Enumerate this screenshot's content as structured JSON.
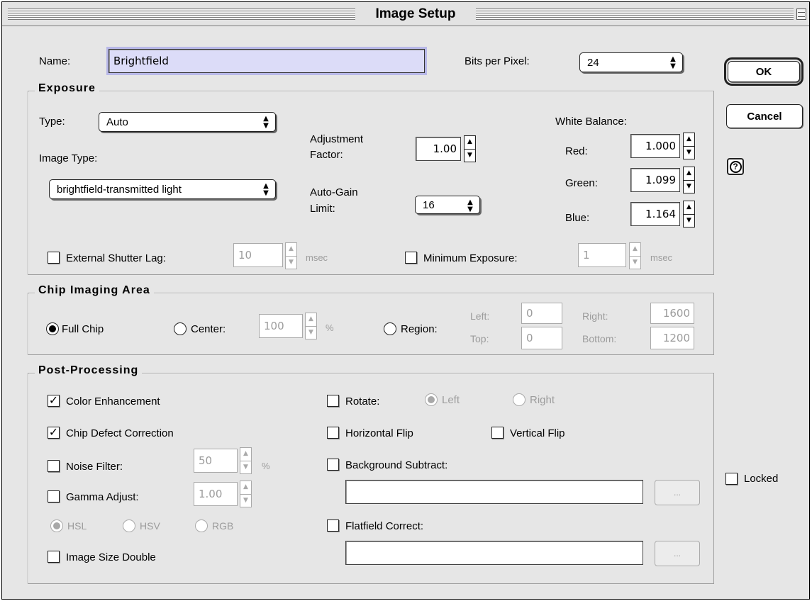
{
  "window": {
    "title": "Image Setup"
  },
  "top": {
    "name_label": "Name:",
    "name_value": "Brightfield",
    "bits_label": "Bits per Pixel:",
    "bits_value": "24"
  },
  "buttons": {
    "ok": "OK",
    "cancel": "Cancel",
    "locked": "Locked"
  },
  "exposure": {
    "title": "Exposure",
    "type_label": "Type:",
    "type_value": "Auto",
    "image_type_label": "Image Type:",
    "image_type_value": "brightfield-transmitted light",
    "adjustment_label_1": "Adjustment",
    "adjustment_label_2": "Factor:",
    "adjustment_value": "1.00",
    "autogain_label_1": "Auto-Gain",
    "autogain_label_2": "Limit:",
    "autogain_value": "16",
    "white_balance_label": "White Balance:",
    "red_label": "Red:",
    "red_value": "1.000",
    "green_label": "Green:",
    "green_value": "1.099",
    "blue_label": "Blue:",
    "blue_value": "1.164",
    "shutter_lag_label": "External Shutter Lag:",
    "shutter_lag_value": "10",
    "shutter_lag_unit": "msec",
    "min_exposure_label": "Minimum Exposure:",
    "min_exposure_value": "1",
    "min_exposure_unit": "msec"
  },
  "chip": {
    "title": "Chip Imaging Area",
    "full_chip": "Full Chip",
    "center": "Center:",
    "center_value": "100",
    "center_unit": "%",
    "region": "Region:",
    "left_label": "Left:",
    "left_value": "0",
    "top_label": "Top:",
    "top_value": "0",
    "right_label": "Right:",
    "right_value": "1600",
    "bottom_label": "Bottom:",
    "bottom_value": "1200"
  },
  "post": {
    "title": "Post-Processing",
    "color_enhancement": "Color Enhancement",
    "chip_defect": "Chip Defect Correction",
    "noise_filter": "Noise Filter:",
    "noise_value": "50",
    "noise_unit": "%",
    "gamma_adjust": "Gamma Adjust:",
    "gamma_value": "1.00",
    "hsl": "HSL",
    "hsv": "HSV",
    "rgb": "RGB",
    "image_size_double": "Image Size Double",
    "rotate": "Rotate:",
    "rotate_left": "Left",
    "rotate_right": "Right",
    "horizontal_flip": "Horizontal Flip",
    "vertical_flip": "Vertical Flip",
    "background_subtract": "Background Subtract:",
    "background_path": "",
    "flatfield_correct": "Flatfield Correct:",
    "flatfield_path": "",
    "browse": "..."
  }
}
